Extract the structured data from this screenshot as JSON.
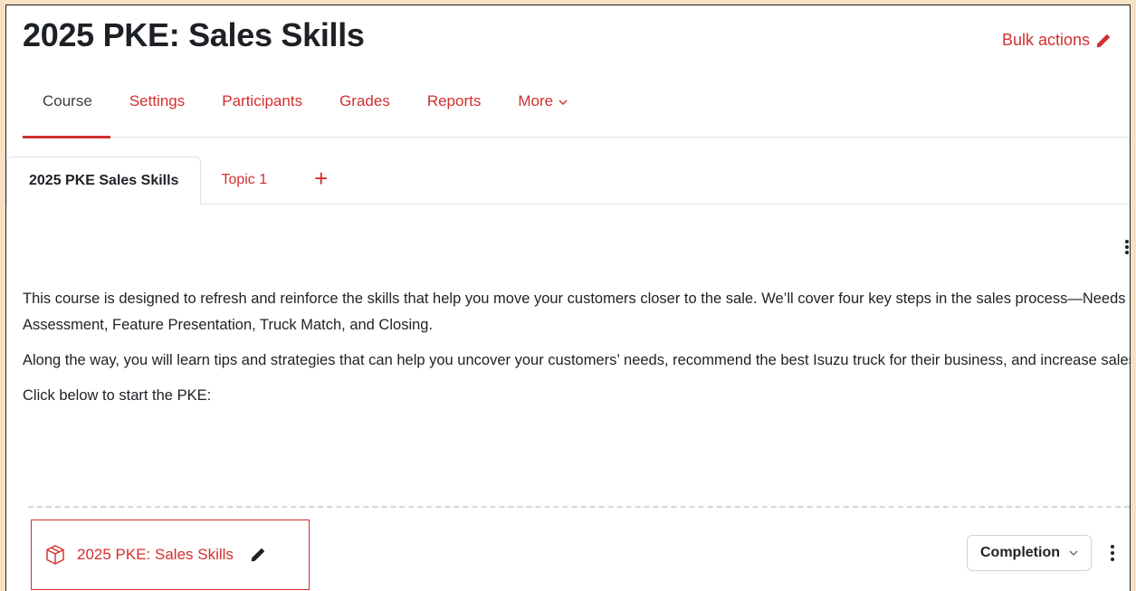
{
  "header": {
    "title": "2025 PKE: Sales Skills",
    "bulk_actions_label": "Bulk actions"
  },
  "nav": {
    "items": [
      {
        "label": "Course"
      },
      {
        "label": "Settings"
      },
      {
        "label": "Participants"
      },
      {
        "label": "Grades"
      },
      {
        "label": "Reports"
      },
      {
        "label": "More"
      }
    ]
  },
  "tabs": {
    "items": [
      {
        "label": "2025 PKE Sales Skills"
      },
      {
        "label": "Topic 1"
      },
      {
        "label": "+"
      }
    ]
  },
  "description": {
    "para1": "This course is designed to refresh and reinforce the skills that help you move your customers closer to the sale. We’ll cover four key steps in the sales process—Needs Assessment, Feature Presentation, Truck Match, and Closing.",
    "para2": "Along the way, you will learn tips and strategies that can help you uncover your customers’ needs, recommend the best Isuzu truck for their business, and increase sales.",
    "para3": "Click below to start the PKE:"
  },
  "activity": {
    "title": "2025 PKE: Sales Skills",
    "icon": "package-icon",
    "completion_label": "Completion"
  },
  "colors": {
    "accent": "#d32f2f",
    "text": "#1d2125",
    "outer_background": "#f7e1c4"
  }
}
